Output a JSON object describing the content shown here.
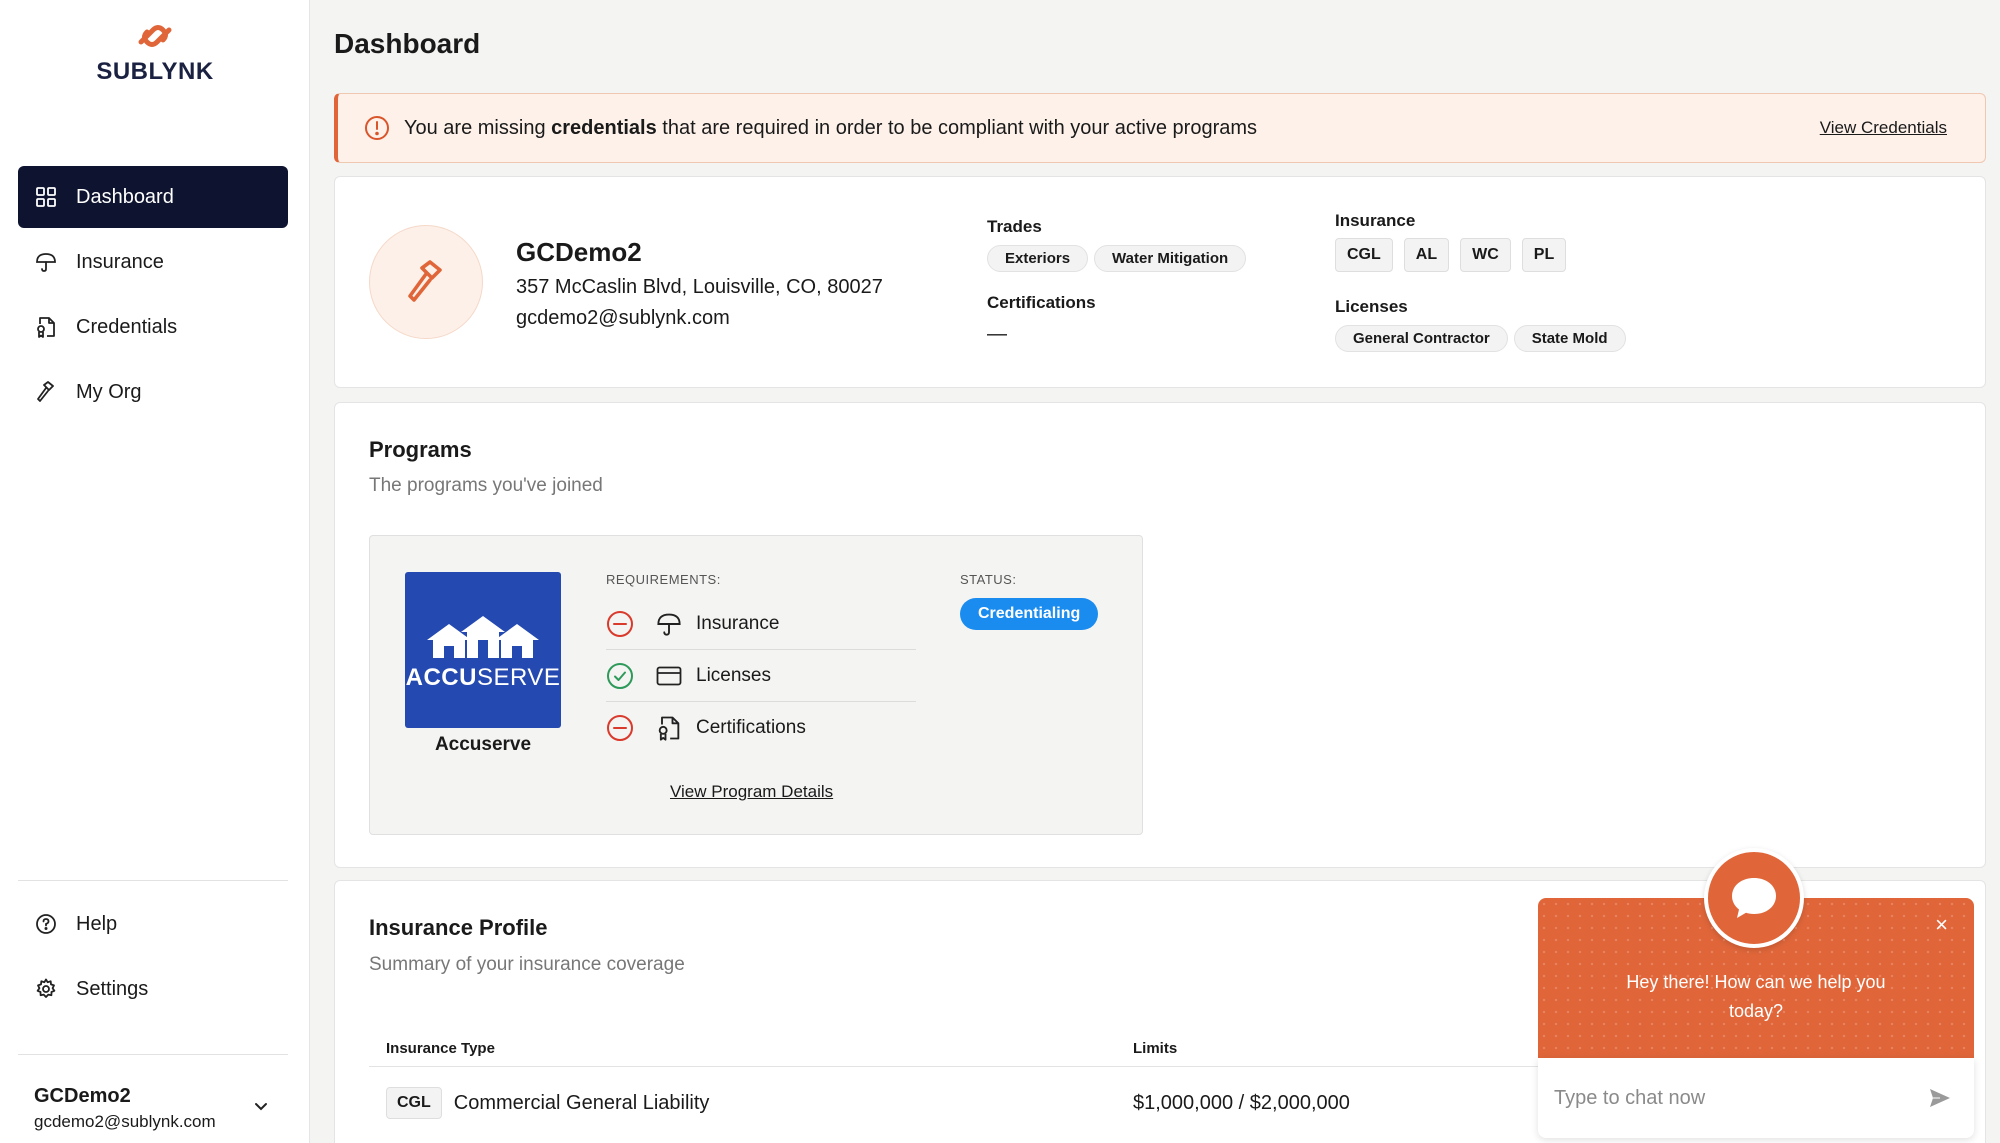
{
  "brand": {
    "name": "SUBLYNK",
    "accent": "#e0663a",
    "nav_dark": "#0e1430"
  },
  "sidebar": {
    "items": [
      {
        "label": "Dashboard",
        "icon": "grid-icon",
        "active": true
      },
      {
        "label": "Insurance",
        "icon": "umbrella-icon",
        "active": false
      },
      {
        "label": "Credentials",
        "icon": "document-badge-icon",
        "active": false
      },
      {
        "label": "My Org",
        "icon": "hammer-icon",
        "active": false
      }
    ],
    "bottom": [
      {
        "label": "Help",
        "icon": "help-circle-icon"
      },
      {
        "label": "Settings",
        "icon": "gear-icon"
      }
    ],
    "user": {
      "name": "GCDemo2",
      "email": "gcdemo2@sublynk.com"
    }
  },
  "page": {
    "title": "Dashboard"
  },
  "alert": {
    "prefix": "You are missing ",
    "bold": "credentials",
    "suffix": " that are required in order to be compliant with your active programs",
    "link": "View Credentials"
  },
  "profile": {
    "name": "GCDemo2",
    "address": "357 McCaslin Blvd, Louisville, CO, 80027",
    "email": "gcdemo2@sublynk.com",
    "trades_label": "Trades",
    "trades": [
      "Exteriors",
      "Water Mitigation"
    ],
    "certifications_label": "Certifications",
    "certifications_value": "—",
    "insurance_label": "Insurance",
    "insurance": [
      "CGL",
      "AL",
      "WC",
      "PL"
    ],
    "licenses_label": "Licenses",
    "licenses": [
      "General Contractor",
      "State Mold"
    ]
  },
  "programs": {
    "title": "Programs",
    "subtitle": "The programs you've joined",
    "items": [
      {
        "logo_text_bold": "ACCU",
        "logo_text": "SERVE",
        "name": "Accuserve",
        "requirements_label": "REQUIREMENTS:",
        "requirements": [
          {
            "label": "Insurance",
            "status": "missing",
            "icon": "umbrella-icon"
          },
          {
            "label": "Licenses",
            "status": "complete",
            "icon": "card-icon"
          },
          {
            "label": "Certifications",
            "status": "missing",
            "icon": "document-badge-icon"
          }
        ],
        "status_label": "STATUS:",
        "status": "Credentialing",
        "link": "View Program Details"
      }
    ]
  },
  "insurance_profile": {
    "title": "Insurance Profile",
    "subtitle": "Summary of your insurance coverage",
    "columns": [
      "Insurance Type",
      "Limits"
    ],
    "rows": [
      {
        "code": "CGL",
        "type": "Commercial General Liability",
        "limits": "$1,000,000 / $2,000,000"
      }
    ]
  },
  "chat": {
    "message": "Hey there! How can we help you today?",
    "placeholder": "Type to chat now",
    "close": "×"
  }
}
